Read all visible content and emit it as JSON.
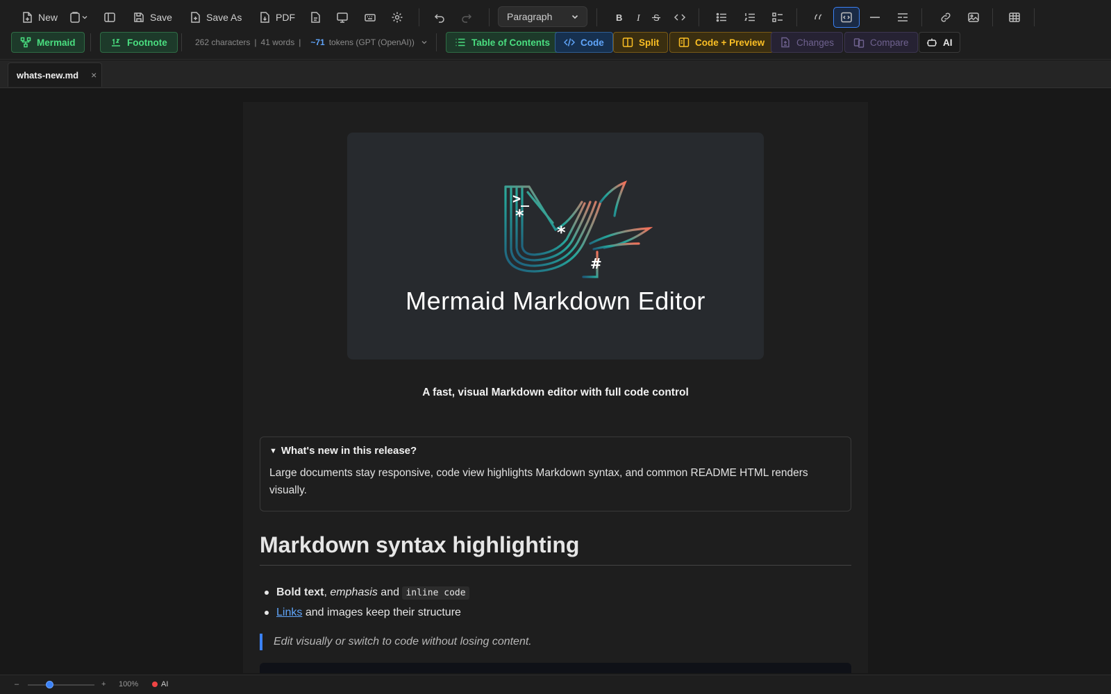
{
  "toolbar": {
    "new_label": "New",
    "save_label": "Save",
    "save_as_label": "Save As",
    "pdf_label": "PDF",
    "format_select": "Paragraph"
  },
  "toolbar2": {
    "mermaid_label": "Mermaid",
    "footnote_label": "Footnote",
    "characters": "262 characters",
    "words": "41 words",
    "tokens_value": "~71",
    "tokens_text": "tokens (GPT (OpenAI))",
    "toc_label": "Table of Contents",
    "code_label": "Code",
    "split_label": "Split",
    "code_preview_label": "Code + Preview",
    "changes_label": "Changes",
    "compare_label": "Compare",
    "ai_label": "AI"
  },
  "tabs": [
    {
      "label": "whats-new.md",
      "close": "×"
    }
  ],
  "document": {
    "banner_title": "Mermaid Markdown Editor",
    "tagline": "A fast, visual Markdown editor with full code control",
    "details_summary": "What's new in this release?",
    "details_body": "Large documents stay responsive, code view highlights Markdown syntax, and common README HTML renders visually.",
    "heading": "Markdown syntax highlighting",
    "list1_bold": "Bold text",
    "list1_comma": ",",
    "list1_em": "emphasis",
    "list1_and": "and",
    "list1_code": "inline code",
    "list2_link": "Links",
    "list2_rest": "and images keep their structure",
    "quote": "Edit visually or switch to code without losing content."
  },
  "status": {
    "zoom_minus": "–",
    "zoom_plus": "+",
    "zoom_percent": "100%",
    "zoom_level": 0.33,
    "ai_label": "AI",
    "ai_color": "#ef4444"
  },
  "colors": {
    "accent": "#3b82f6",
    "green": "#4ade80",
    "yellow": "#fbbf24"
  }
}
